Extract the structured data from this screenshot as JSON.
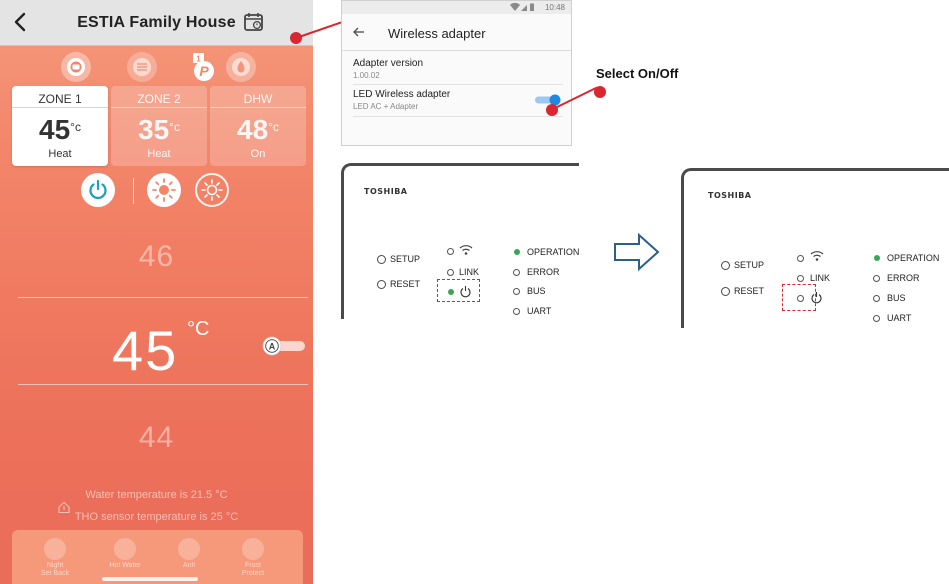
{
  "app": {
    "title": "ESTIA Family House",
    "zones": [
      {
        "name": "ZONE 1",
        "temp": "45",
        "unit": "°c",
        "mode": "Heat",
        "active": true
      },
      {
        "name": "ZONE 2",
        "temp": "35",
        "unit": "°c",
        "mode": "Heat",
        "active": false
      },
      {
        "name": "DHW",
        "temp": "48",
        "unit": "°c",
        "mode": "On",
        "active": false
      }
    ],
    "set_temp_upper": "46",
    "set_temp": "45",
    "set_temp_unit": "°C",
    "set_temp_lower": "44",
    "water_temp_text": "Water temperature is 21.5 °C",
    "tho_sensor_text": "THO sensor temperature is 25 °C",
    "tray_items": [
      {
        "label": "Night\nSet Back",
        "icon": "moon-icon"
      },
      {
        "label": "Hot Water",
        "icon": "hot-water-icon"
      },
      {
        "label": "Anti",
        "icon": "fan-icon"
      },
      {
        "label": "Frost\nProtect",
        "icon": "frost-icon"
      }
    ]
  },
  "settings": {
    "status_time": "10:48",
    "title": "Wireless adapter",
    "adapter_version_label": "Adapter version",
    "adapter_version_value": "1.00.02",
    "led_label": "LED Wireless adapter",
    "led_sub": "LED AC + Adapter",
    "led_enabled": true
  },
  "callout": {
    "text": "Select On/Off"
  },
  "panel_left": {
    "brand": "TOSHIBA",
    "setup": "SETUP",
    "reset": "RESET",
    "link": "LINK",
    "operation": "OPERATION",
    "error": "ERROR",
    "bus": "BUS",
    "uart": "UART",
    "power_led_on": true
  },
  "panel_right": {
    "brand": "TOSHIBA",
    "setup": "SETUP",
    "reset": "RESET",
    "link": "LINK",
    "operation": "OPERATION",
    "error": "ERROR",
    "bus": "BUS",
    "uart": "UART",
    "power_led_on": false
  },
  "colors": {
    "accent_red": "#d92630",
    "app_gradient_top": "#f49a7c",
    "app_gradient_bottom": "#ea6c5a",
    "power_teal": "#1aa0b8",
    "toggle_blue": "#1e88e5",
    "led_green": "#3aa655",
    "arrow_blue": "#2c5f8a"
  }
}
